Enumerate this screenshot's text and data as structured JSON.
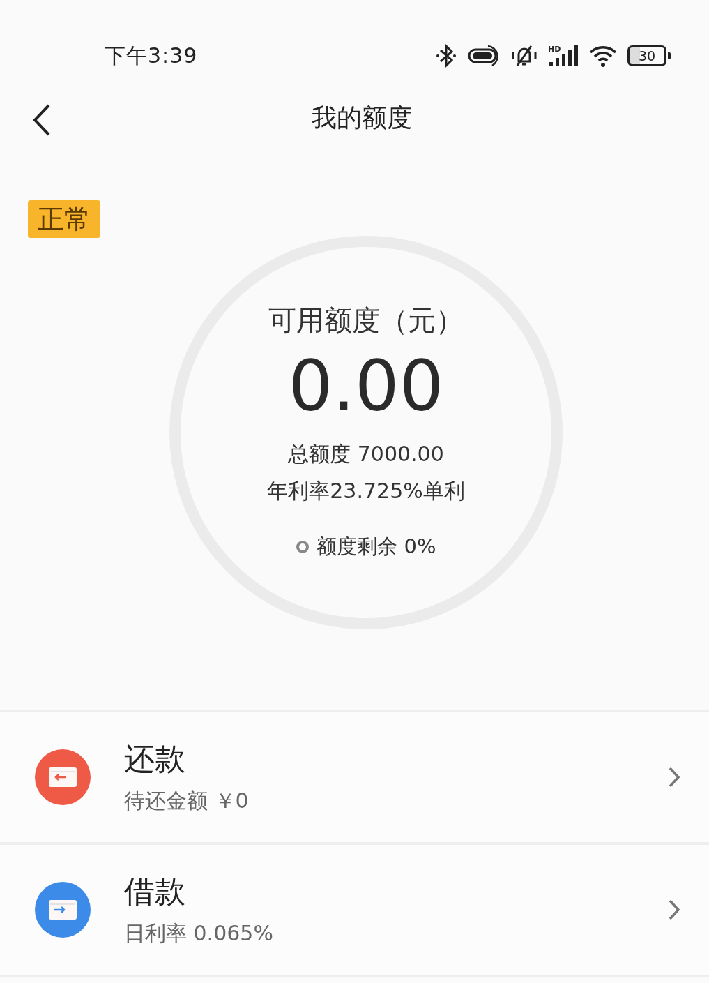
{
  "status_bar": {
    "time": "下午3:39",
    "network": "HD",
    "battery": "30"
  },
  "header": {
    "title": "我的额度"
  },
  "status_badge": "正常",
  "quota": {
    "label": "可用额度（元）",
    "amount": "0.00",
    "total": "总额度 7000.00",
    "rate": "年利率23.725%单利",
    "remaining": "额度剩余 0%"
  },
  "actions": [
    {
      "kind": "repay",
      "title": "还款",
      "subtitle": "待还金额 ￥0",
      "color": "#ee5a45"
    },
    {
      "kind": "borrow",
      "title": "借款",
      "subtitle": "日利率 0.065%",
      "color": "#3d8be8"
    }
  ]
}
